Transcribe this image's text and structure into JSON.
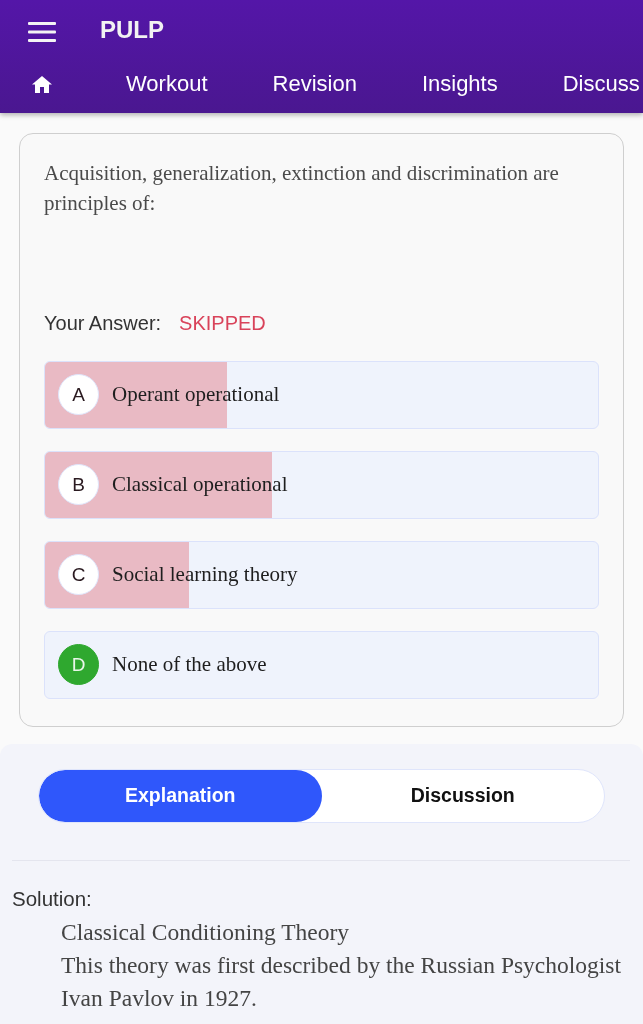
{
  "app_bar": {
    "title": "PULP"
  },
  "nav": {
    "tabs": [
      "Workout",
      "Revision",
      "Insights",
      "Discuss"
    ]
  },
  "question": {
    "text": "Acquisition, generalization, extinction and discrimination are principles of:",
    "answer_label": "Your Answer:",
    "answer_value": "SKIPPED"
  },
  "options": [
    {
      "letter": "A",
      "text": "Operant operational",
      "level": 0.33,
      "correct": false
    },
    {
      "letter": "B",
      "text": "Classical operational",
      "level": 0.41,
      "correct": false
    },
    {
      "letter": "C",
      "text": "Social learning theory",
      "level": 0.26,
      "correct": false
    },
    {
      "letter": "D",
      "text": "None of the above",
      "level": 0,
      "correct": true
    }
  ],
  "toggle": [
    {
      "label": "Explanation",
      "selected": true
    },
    {
      "label": "Discussion",
      "selected": false
    }
  ],
  "solution": {
    "label": "Solution:",
    "title": "Classical Conditioning Theory",
    "text": "This theory was first described by the Russian Psychologist Ivan Pavlov in 1927."
  }
}
